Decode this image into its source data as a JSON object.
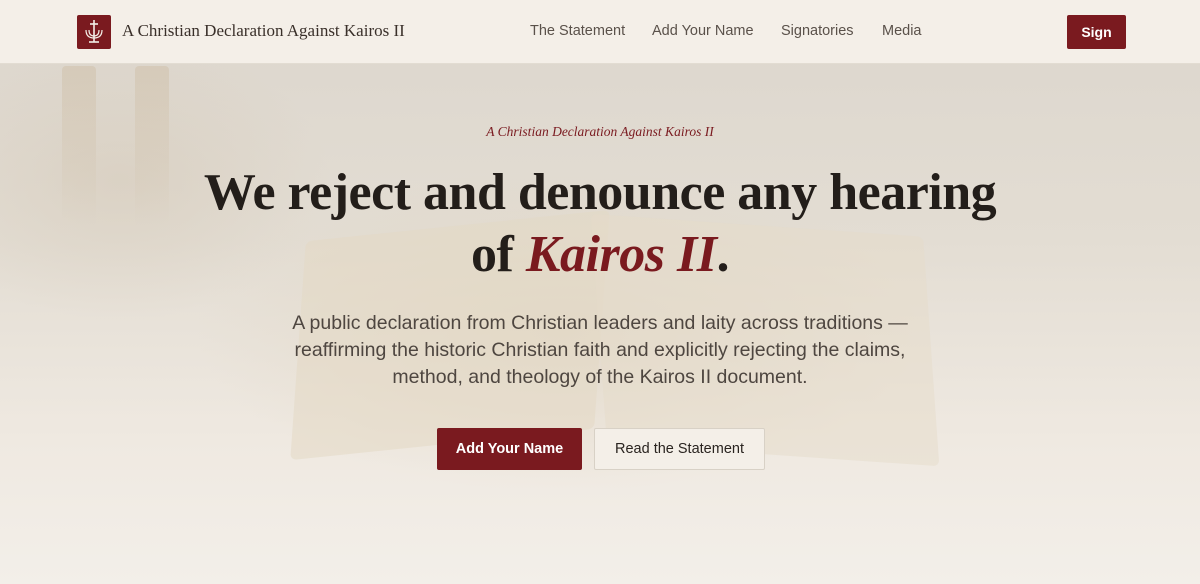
{
  "header": {
    "brand": "A Christian Declaration Against Kairos II",
    "nav": [
      {
        "label": "The Statement"
      },
      {
        "label": "Add Your Name"
      },
      {
        "label": "Signatories"
      },
      {
        "label": "Media"
      }
    ],
    "sign_label": "Sign"
  },
  "hero": {
    "eyebrow": "A Christian Declaration Against Kairos II",
    "headline_part1": "We reject and denounce any hearing",
    "headline_part2": "of ",
    "headline_em": "Kairos II",
    "headline_end": ".",
    "subtitle": "A public declaration from Christian leaders and laity across traditions — reaffirming the historic Christian faith and explicitly rejecting the claims, method, and theology of the Kairos II document.",
    "primary_button": "Add Your Name",
    "secondary_button": "Read the Statement"
  },
  "colors": {
    "accent": "#7a1a1f",
    "background": "#f1ece4"
  },
  "icons": {
    "logo": "menorah-cross-icon"
  }
}
